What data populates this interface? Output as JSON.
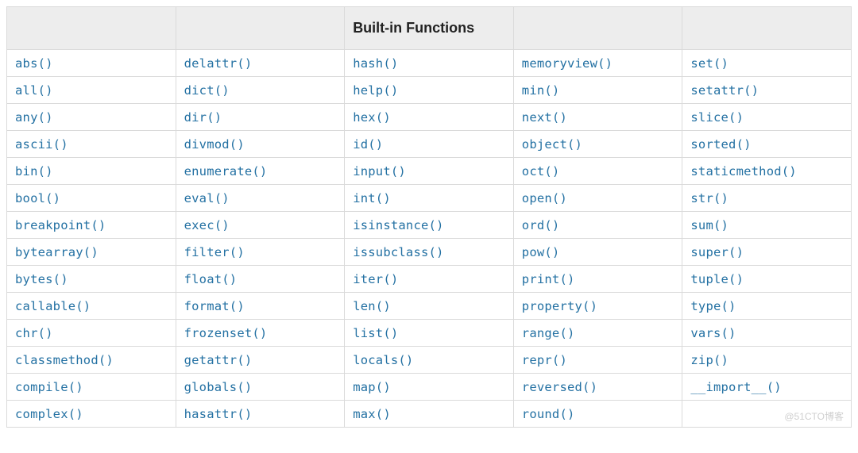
{
  "header": {
    "col0": "",
    "col1": "",
    "col2": "Built-in Functions",
    "col3": "",
    "col4": ""
  },
  "rows": [
    [
      "abs()",
      "delattr()",
      "hash()",
      "memoryview()",
      "set()"
    ],
    [
      "all()",
      "dict()",
      "help()",
      "min()",
      "setattr()"
    ],
    [
      "any()",
      "dir()",
      "hex()",
      "next()",
      "slice()"
    ],
    [
      "ascii()",
      "divmod()",
      "id()",
      "object()",
      "sorted()"
    ],
    [
      "bin()",
      "enumerate()",
      "input()",
      "oct()",
      "staticmethod()"
    ],
    [
      "bool()",
      "eval()",
      "int()",
      "open()",
      "str()"
    ],
    [
      "breakpoint()",
      "exec()",
      "isinstance()",
      "ord()",
      "sum()"
    ],
    [
      "bytearray()",
      "filter()",
      "issubclass()",
      "pow()",
      "super()"
    ],
    [
      "bytes()",
      "float()",
      "iter()",
      "print()",
      "tuple()"
    ],
    [
      "callable()",
      "format()",
      "len()",
      "property()",
      "type()"
    ],
    [
      "chr()",
      "frozenset()",
      "list()",
      "range()",
      "vars()"
    ],
    [
      "classmethod()",
      "getattr()",
      "locals()",
      "repr()",
      "zip()"
    ],
    [
      "compile()",
      "globals()",
      "map()",
      "reversed()",
      "__import__()"
    ],
    [
      "complex()",
      "hasattr()",
      "max()",
      "round()",
      ""
    ]
  ],
  "watermark": "@51CTO博客"
}
